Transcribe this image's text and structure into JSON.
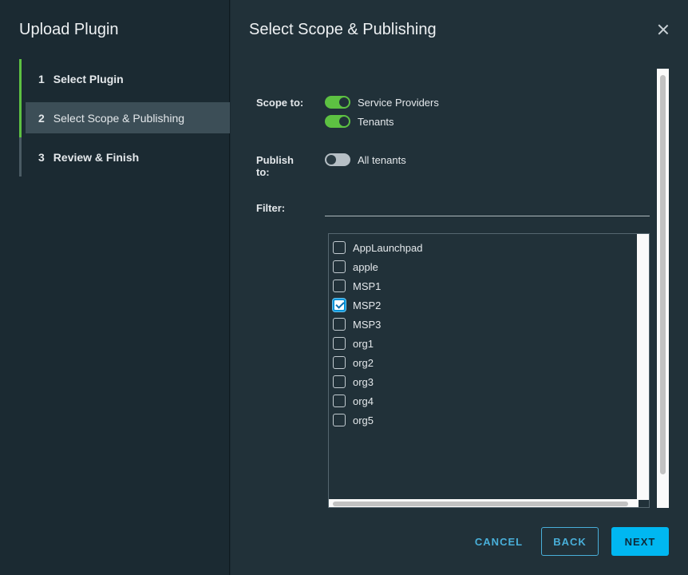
{
  "sidebar": {
    "title": "Upload Plugin",
    "steps": [
      {
        "num": "1",
        "label": "Select Plugin",
        "state": "done"
      },
      {
        "num": "2",
        "label": "Select Scope & Publishing",
        "state": "active"
      },
      {
        "num": "3",
        "label": "Review & Finish",
        "state": "idle"
      }
    ]
  },
  "main": {
    "title": "Select Scope & Publishing",
    "scope_label": "Scope to:",
    "scope_options": [
      {
        "label": "Service Providers",
        "on": true
      },
      {
        "label": "Tenants",
        "on": true
      }
    ],
    "publish_label_1": "Publish",
    "publish_label_2": "to:",
    "publish_option": {
      "label": "All tenants",
      "on": false
    },
    "filter_label": "Filter:",
    "filter_value": "",
    "tenants": [
      {
        "name": "AppLaunchpad",
        "checked": false
      },
      {
        "name": "apple",
        "checked": false
      },
      {
        "name": "MSP1",
        "checked": false
      },
      {
        "name": "MSP2",
        "checked": true
      },
      {
        "name": "MSP3",
        "checked": false
      },
      {
        "name": "org1",
        "checked": false
      },
      {
        "name": "org2",
        "checked": false
      },
      {
        "name": "org3",
        "checked": false
      },
      {
        "name": "org4",
        "checked": false
      },
      {
        "name": "org5",
        "checked": false
      }
    ]
  },
  "footer": {
    "cancel": "CANCEL",
    "back": "BACK",
    "next": "NEXT"
  },
  "colors": {
    "accent": "#00b7f1",
    "toggle_on": "#5dc142",
    "link": "#49afd9"
  },
  "icons": {
    "close": "close-icon",
    "check": "checkmark-icon"
  }
}
